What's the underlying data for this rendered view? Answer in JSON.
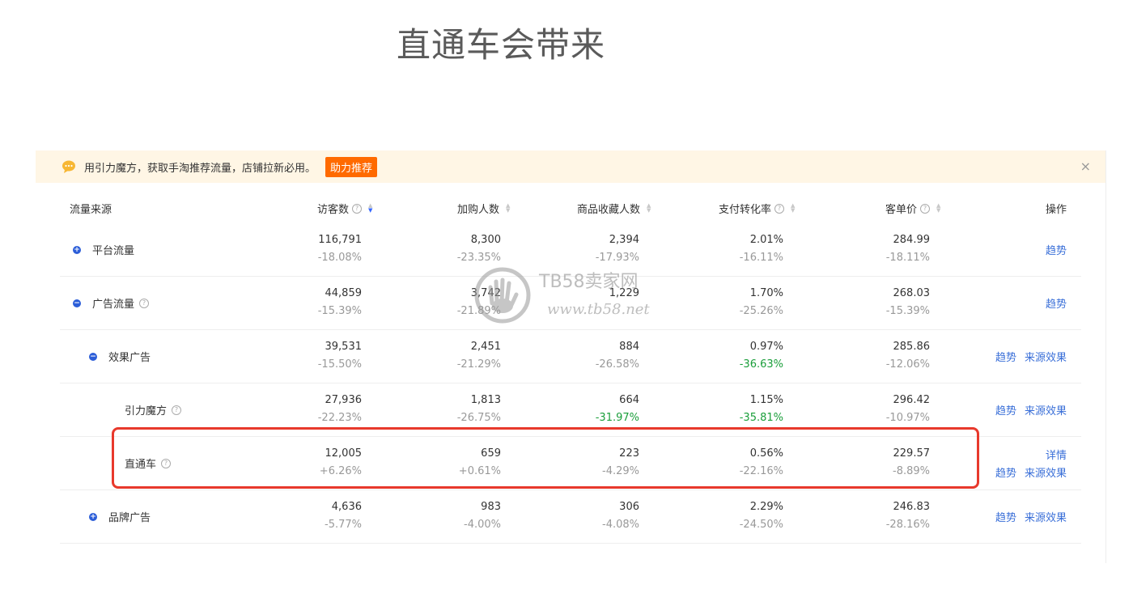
{
  "heading": "直通车会带来",
  "notice": {
    "text": "用引力魔方，获取手淘推荐流量，店铺拉新必用。",
    "cta": "助力推荐",
    "close": "×"
  },
  "columns": {
    "source": "流量来源",
    "visitors": "访客数",
    "cart": "加购人数",
    "favorites": "商品收藏人数",
    "conversion": "支付转化率",
    "price": "客单价",
    "ops": "操作"
  },
  "rows": [
    {
      "name": "平台流量",
      "visitors": "116,791",
      "visitors_pct": "-18.08%",
      "cart": "8,300",
      "cart_pct": "-23.35%",
      "fav": "2,394",
      "fav_pct": "-17.93%",
      "conv": "2.01%",
      "conv_pct": "-16.11%",
      "price": "284.99",
      "price_pct": "-18.11%",
      "op1": "趋势"
    },
    {
      "name": "广告流量",
      "visitors": "44,859",
      "visitors_pct": "-15.39%",
      "cart": "3,742",
      "cart_pct": "-21.89%",
      "fav": "1,229",
      "fav_pct": "",
      "conv": "1.70%",
      "conv_pct": "-25.26%",
      "price": "268.03",
      "price_pct": "-15.39%",
      "op1": "趋势"
    },
    {
      "name": "效果广告",
      "visitors": "39,531",
      "visitors_pct": "-15.50%",
      "cart": "2,451",
      "cart_pct": "-21.29%",
      "fav": "884",
      "fav_pct": "-26.58%",
      "conv": "0.97%",
      "conv_pct": "-36.63%",
      "price": "285.86",
      "price_pct": "-12.06%",
      "op1": "趋势",
      "op2": "来源效果"
    },
    {
      "name": "引力魔方",
      "visitors": "27,936",
      "visitors_pct": "-22.23%",
      "cart": "1,813",
      "cart_pct": "-26.75%",
      "fav": "664",
      "fav_pct": "-31.97%",
      "conv": "1.15%",
      "conv_pct": "-35.81%",
      "price": "296.42",
      "price_pct": "-10.97%",
      "op1": "趋势",
      "op2": "来源效果"
    },
    {
      "name": "直通车",
      "visitors": "12,005",
      "visitors_pct": "+6.26%",
      "cart": "659",
      "cart_pct": "+0.61%",
      "fav": "223",
      "fav_pct": "-4.29%",
      "conv": "0.56%",
      "conv_pct": "-22.16%",
      "price": "229.57",
      "price_pct": "-8.89%",
      "op0": "详情",
      "op1": "趋势",
      "op2": "来源效果"
    },
    {
      "name": "品牌广告",
      "visitors": "4,636",
      "visitors_pct": "-5.77%",
      "cart": "983",
      "cart_pct": "-4.00%",
      "fav": "306",
      "fav_pct": "-4.08%",
      "conv": "2.29%",
      "conv_pct": "-24.50%",
      "price": "246.83",
      "price_pct": "-28.16%",
      "op1": "趋势",
      "op2": "来源效果"
    }
  ],
  "watermark": {
    "line1": "TB58卖家网",
    "line2": "www.tb58.net"
  },
  "colors": {
    "accent": "#3a6fd8",
    "toggle": "#2c5ed8",
    "cta": "#ff6a00",
    "highlight": "#e8392c",
    "negative_green": "#1a9e3a"
  }
}
